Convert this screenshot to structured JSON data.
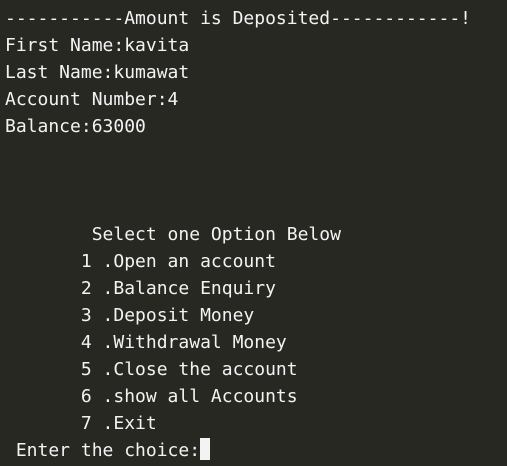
{
  "terminal": {
    "header_line": "-----------Amount is Deposited------------!",
    "first_name": "First Name:kavita",
    "last_name": "Last Name:kumawat",
    "account_number": "Account Number:4",
    "balance": "Balance:63000",
    "menu_title": "        Select one Option Below",
    "menu_items": [
      "       1 .Open an account",
      "       2 .Balance Enquiry",
      "       3 .Deposit Money",
      "       4 .Withdrawal Money",
      "       5 .Close the account",
      "       6 .show all Accounts",
      "       7 .Exit"
    ],
    "prompt": " Enter the choice:"
  }
}
